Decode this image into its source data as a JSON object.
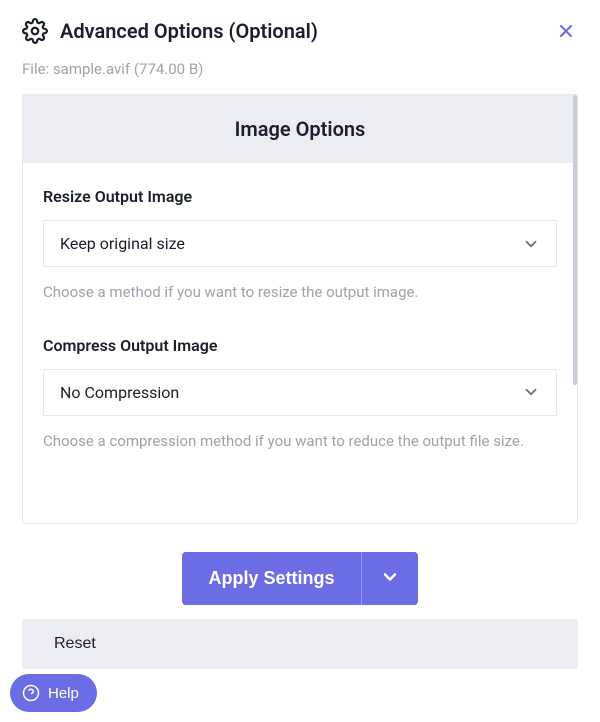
{
  "header": {
    "title": "Advanced Options (Optional)"
  },
  "file": {
    "label": "File:",
    "name": "sample.avif",
    "size": "(774.00 B)"
  },
  "section": {
    "title": "Image Options"
  },
  "resize": {
    "label": "Resize Output Image",
    "value": "Keep original size",
    "help": "Choose a method if you want to resize the output image."
  },
  "compress": {
    "label": "Compress Output Image",
    "value": "No Compression",
    "help": "Choose a compression method if you want to reduce the output file size."
  },
  "footer": {
    "apply": "Apply Settings",
    "reset": "Reset"
  },
  "help": {
    "label": "Help"
  }
}
